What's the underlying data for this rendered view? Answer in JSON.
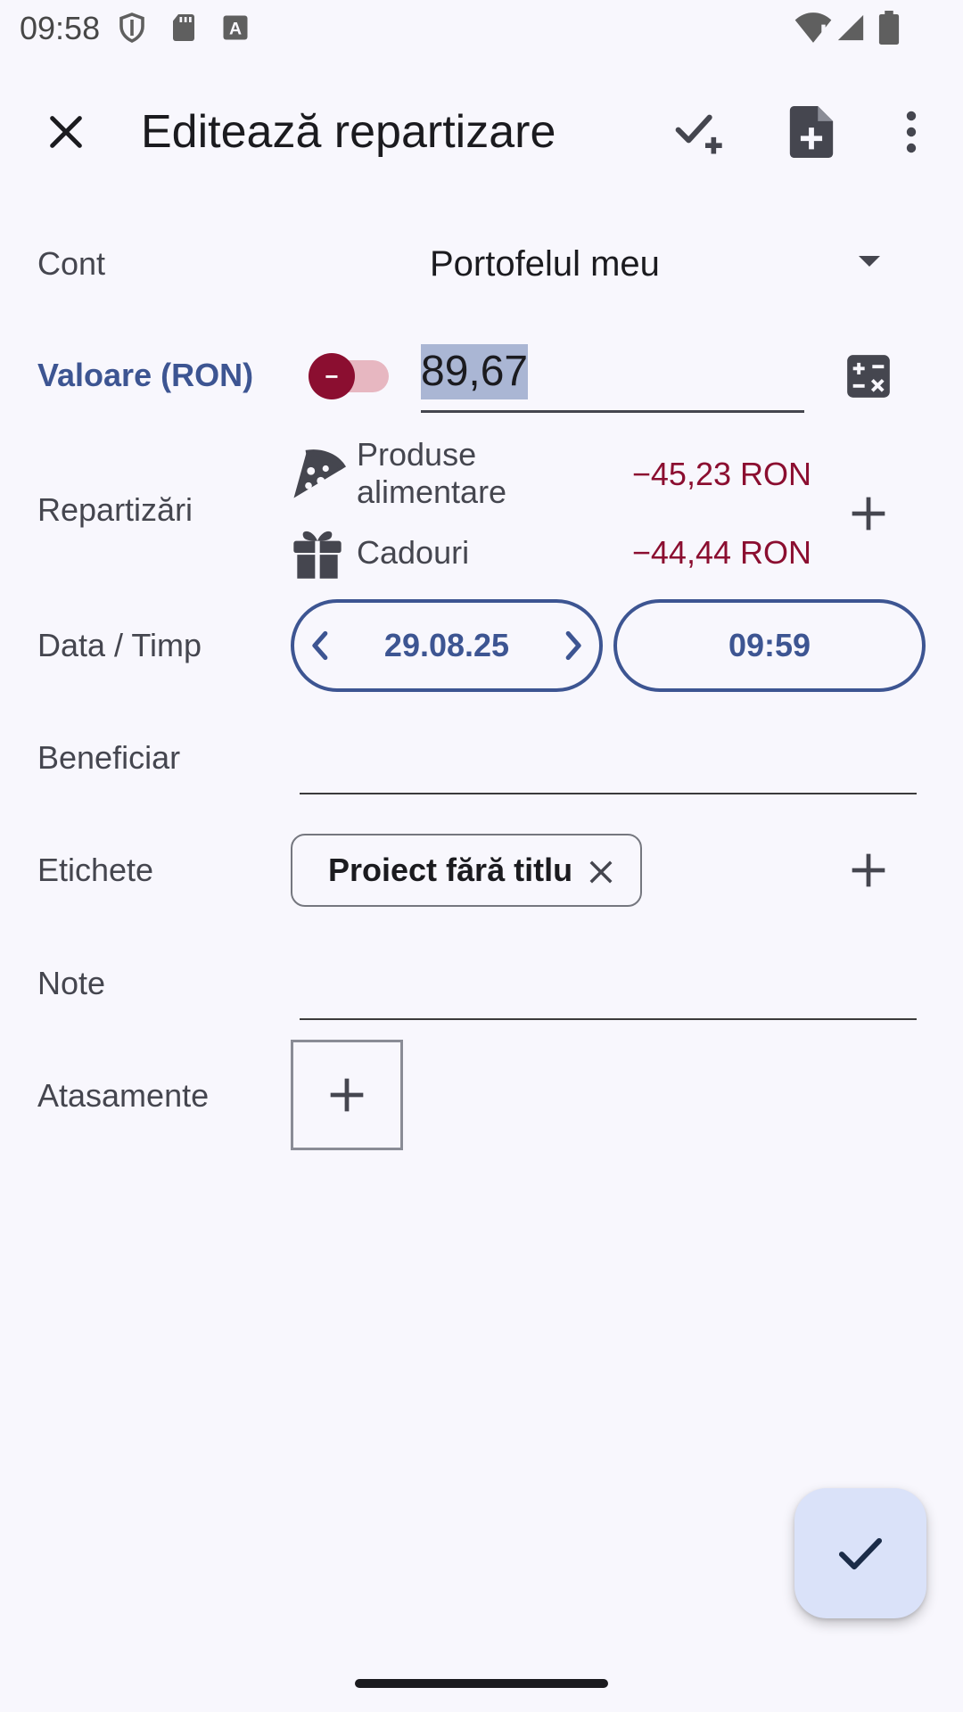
{
  "status_bar": {
    "time": "09:58",
    "icons": [
      "shield-icon",
      "sd-card-icon",
      "keyboard-a-icon",
      "wifi-alert-icon",
      "cell-signal-icon",
      "battery-icon"
    ]
  },
  "app_bar": {
    "title": "Editează repartizare",
    "actions": [
      "close-icon",
      "check-add-icon",
      "new-document-icon",
      "more-vert-icon"
    ]
  },
  "form": {
    "account": {
      "label": "Cont",
      "value": "Portofelul meu"
    },
    "amount": {
      "label": "Valoare (RON)",
      "sign": "−",
      "value": "89,67",
      "selected": true
    },
    "splits": {
      "label": "Repartizări",
      "items": [
        {
          "icon": "pizza-icon",
          "category_line1": "Produse",
          "category_line2": "alimentare",
          "amount": "−45,23 RON"
        },
        {
          "icon": "gift-icon",
          "category_line1": "Cadouri",
          "category_line2": "",
          "amount": "−44,44 RON"
        }
      ]
    },
    "datetime": {
      "label": "Data / Timp",
      "date": "29.08.25",
      "time": "09:59"
    },
    "payee": {
      "label": "Beneficiar",
      "value": ""
    },
    "tags": {
      "label": "Etichete",
      "chips": [
        "Proiect fără titlu"
      ]
    },
    "notes": {
      "label": "Note",
      "value": ""
    },
    "attachments": {
      "label": "Atasamente"
    }
  },
  "colors": {
    "primary": "#3d5592",
    "negative": "#8b0e30",
    "background": "#f8f7fd",
    "fab": "#dae2f9",
    "selection": "#aab6d4"
  }
}
